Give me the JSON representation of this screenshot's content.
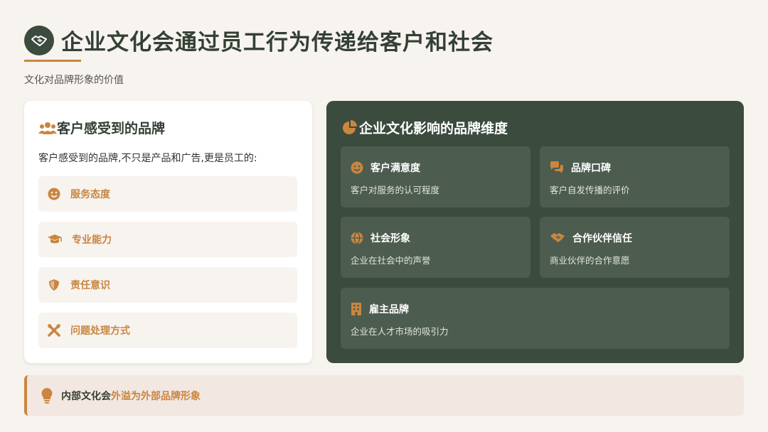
{
  "header": {
    "title": "企业文化会通过员工行为传递给客户和社会",
    "subtitle": "文化对品牌形象的价值",
    "icon": "handshake-icon"
  },
  "left_panel": {
    "title": "客户感受到的品牌",
    "intro": "客户感受到的品牌,不只是产品和广告,更是员工的:",
    "items": [
      {
        "label": "服务态度",
        "icon": "smile-icon"
      },
      {
        "label": "专业能力",
        "icon": "graduation-cap-icon"
      },
      {
        "label": "责任意识",
        "icon": "shield-icon"
      },
      {
        "label": "问题处理方式",
        "icon": "tools-icon"
      }
    ]
  },
  "right_panel": {
    "title": "企业文化影响的品牌维度",
    "dimensions": [
      {
        "name": "客户满意度",
        "desc": "客户对服务的认可程度",
        "icon": "smile-icon"
      },
      {
        "name": "品牌口碑",
        "desc": "客户自发传播的评价",
        "icon": "comments-icon"
      },
      {
        "name": "社会形象",
        "desc": "企业在社会中的声誉",
        "icon": "globe-icon"
      },
      {
        "name": "合作伙伴信任",
        "desc": "商业伙伴的合作意愿",
        "icon": "handshake-icon"
      },
      {
        "name": "雇主品牌",
        "desc": "企业在人才市场的吸引力",
        "icon": "building-icon"
      }
    ]
  },
  "callout": {
    "text_plain": "内部文化会",
    "text_highlight": "外溢为外部品牌形象",
    "icon": "lightbulb-icon"
  },
  "colors": {
    "primary_green": "#3b4b3e",
    "accent_orange": "#c9863f",
    "background": "#f7f3ef"
  }
}
